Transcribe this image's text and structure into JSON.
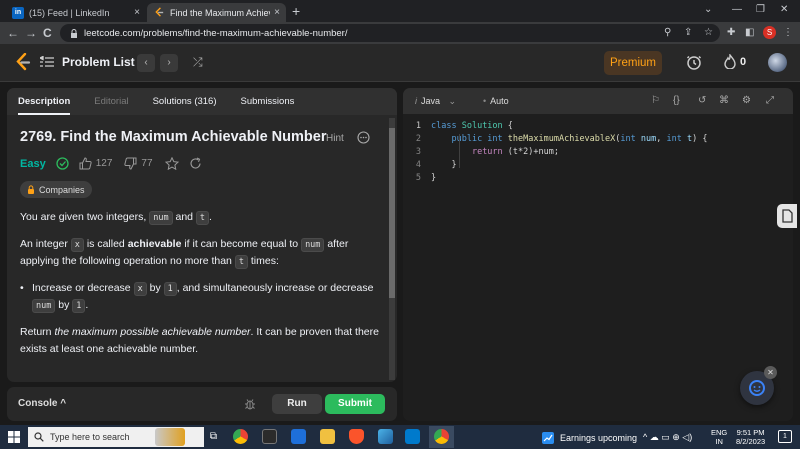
{
  "browser": {
    "tabs": [
      {
        "favicon": "in",
        "title": "(15) Feed | LinkedIn",
        "close": "×"
      },
      {
        "favicon": "",
        "title": "Find the Maximum Achievable N",
        "close": "×"
      }
    ],
    "new_tab": "+",
    "window_controls": [
      "⌄",
      "—",
      "❐",
      "✕"
    ],
    "nav": {
      "back": "←",
      "forward": "→",
      "reload": "C"
    },
    "url": "leetcode.com/problems/find-the-maximum-achievable-number/",
    "profile_initial": "S"
  },
  "lc_nav": {
    "problem_list": "Problem List",
    "prev": "‹",
    "next": "›",
    "shuffle": "⤮",
    "premium": "Premium",
    "streak": "0"
  },
  "tabs": {
    "description": "Description",
    "editorial": "Editorial",
    "solutions": "Solutions (316)",
    "submissions": "Submissions"
  },
  "problem": {
    "title": "2769. Find the Maximum Achievable Number",
    "hint": "Hint",
    "difficulty": "Easy",
    "likes": "127",
    "dislikes": "77",
    "companies": "Companies",
    "p1_a": "You are given two integers, ",
    "p1_num": "num",
    "p1_and": " and ",
    "p1_t": "t",
    "p1_end": ".",
    "p2_a": "An integer ",
    "p2_x": "x",
    "p2_b": " is called ",
    "p2_bold": "achievable",
    "p2_c": " if it can become equal to ",
    "p2_num": "num",
    "p2_d": " after applying the following operation no more than ",
    "p2_t": "t",
    "p2_e": " times:",
    "b1_a": "Increase or decrease ",
    "b1_x": "x",
    "b1_b": " by ",
    "b1_1": "1",
    "b1_c": ", and simultaneously increase or decrease ",
    "b1_num": "num",
    "b1_d": " by ",
    "b1_2": "1",
    "b1_e": ".",
    "p3_a": "Return ",
    "p3_em": "the maximum possible achievable number",
    "p3_b": ". It can be proven that there exists at least one achievable number."
  },
  "console_bar": {
    "console": "Console",
    "caret": "^",
    "run": "Run",
    "submit": "Submit"
  },
  "editor": {
    "language": "Java",
    "auto": "Auto",
    "lines": [
      "1",
      "2",
      "3",
      "4",
      "5"
    ],
    "code": {
      "l1_kw": "class",
      "l1_cls": "Solution",
      "l1_rest": " {",
      "l2_kw": "public int",
      "l2_fn": "theMaximumAchievableX",
      "l2_p": "(",
      "l2_t1": "int",
      "l2_v1": "num",
      "l2_c": ", ",
      "l2_t2": "int",
      "l2_v2": "t",
      "l2_end": ") {",
      "l3_kw": "return",
      "l3_rest": " (t*2)+num;",
      "l4": "}",
      "l5": "}"
    }
  },
  "taskbar": {
    "search_placeholder": "Type here to search",
    "news": "Earnings upcoming",
    "lang_line1": "ENG",
    "lang_line2": "IN",
    "time": "9:51 PM",
    "date": "8/2/2023",
    "notifications": "1"
  },
  "colors": {
    "accent_orange": "#ffa116",
    "easy_teal": "#00b8a3",
    "submit_green": "#2cbb5d"
  }
}
